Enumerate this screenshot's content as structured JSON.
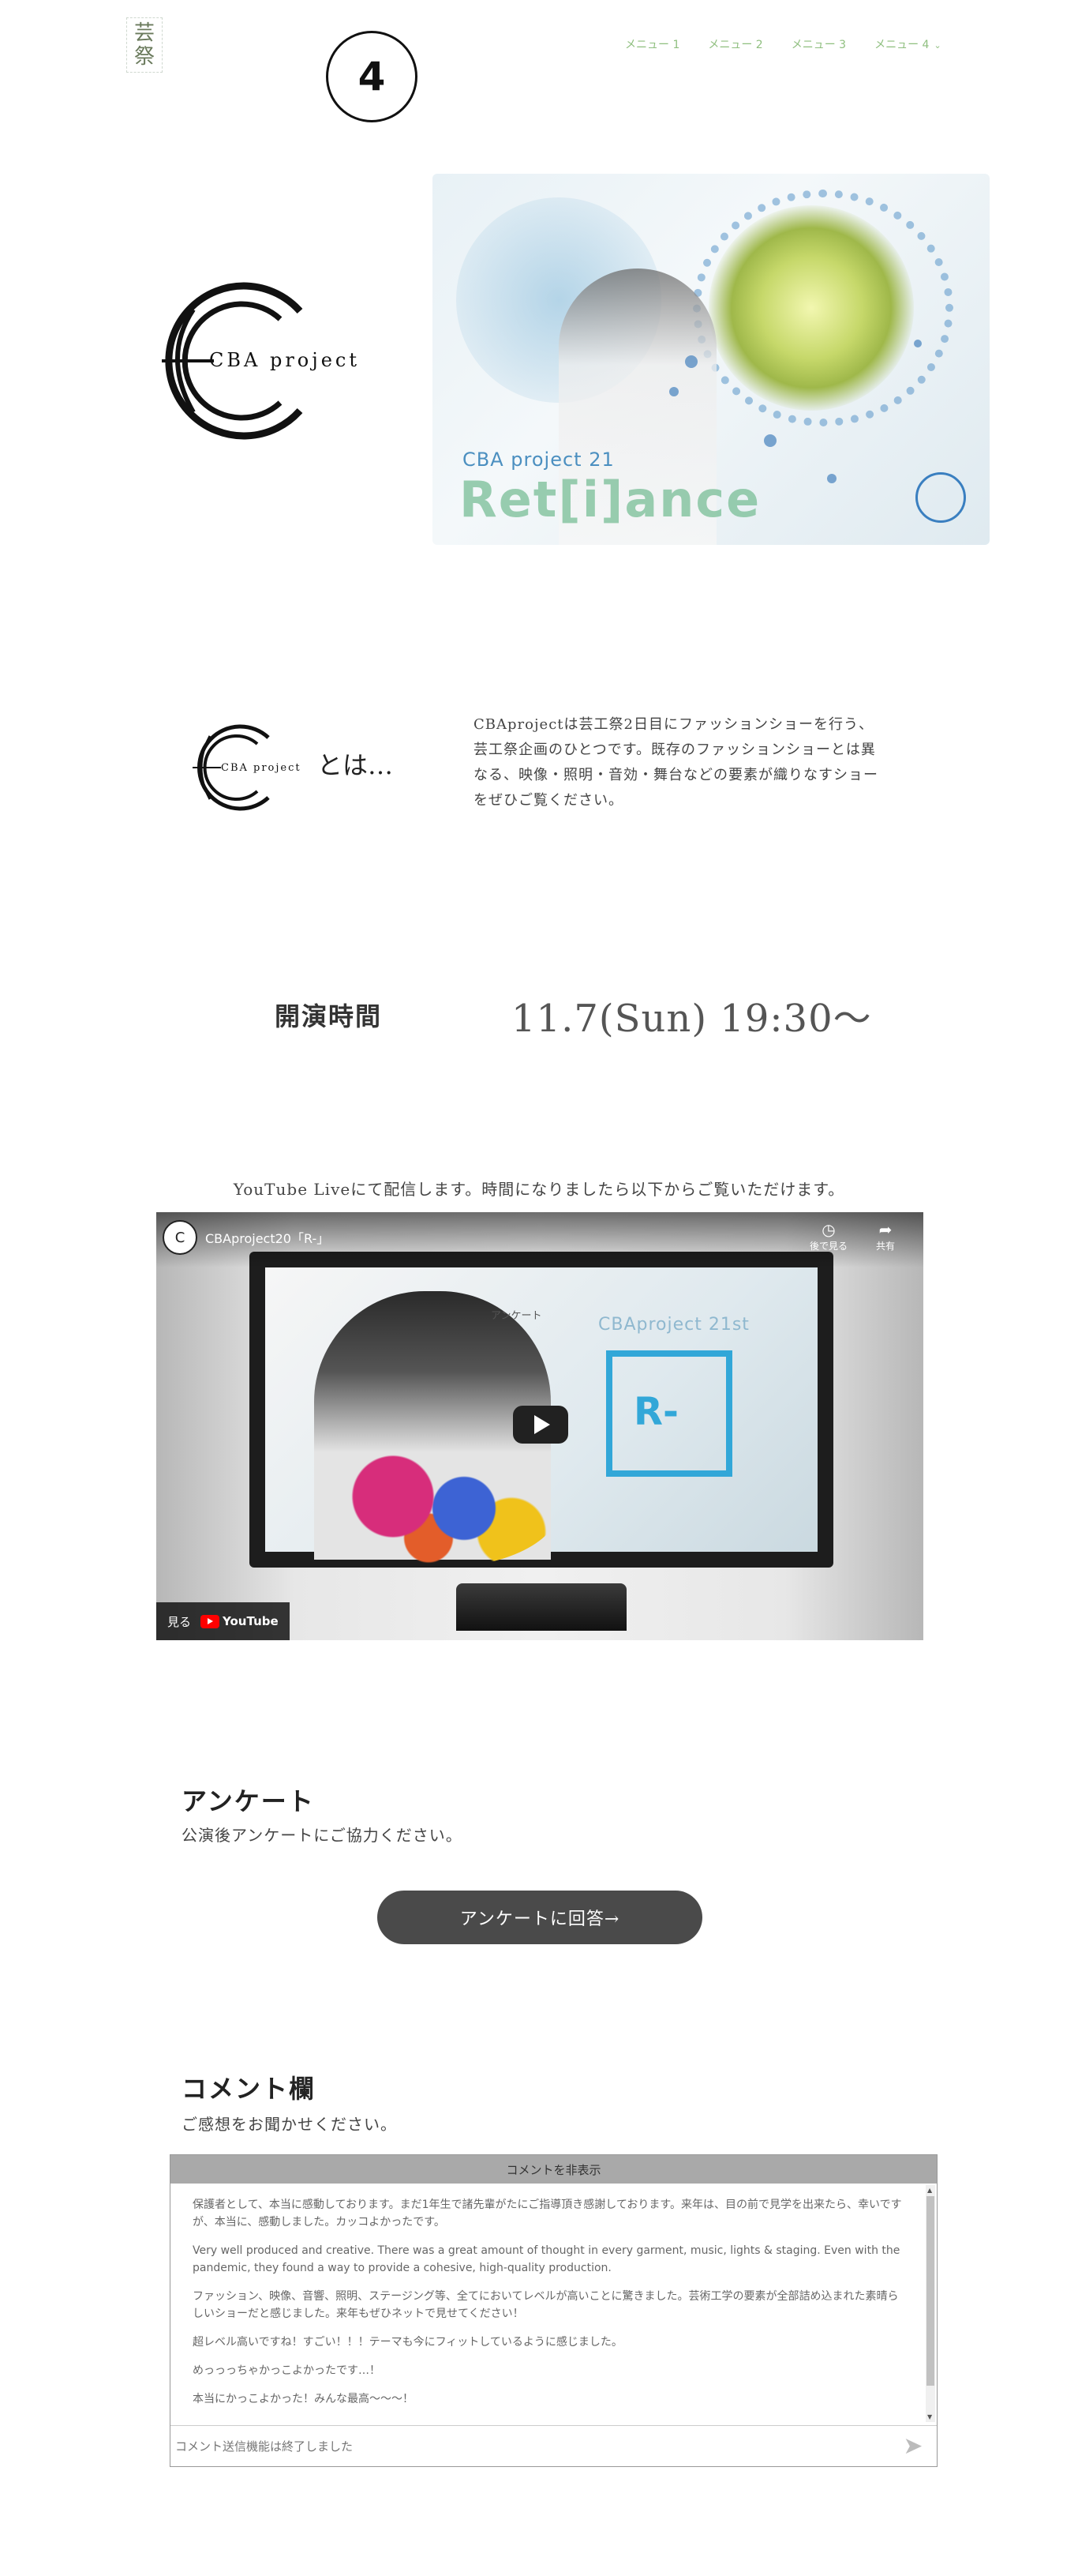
{
  "header": {
    "logo_chars": [
      "芸",
      "祭"
    ],
    "badge_number": "4",
    "nav": [
      {
        "label": "メニュー 1"
      },
      {
        "label": "メニュー 2"
      },
      {
        "label": "メニュー 3"
      },
      {
        "label": "メニュー 4"
      }
    ],
    "accent_color": "#8fbf7f"
  },
  "hero": {
    "logo_text": "CBA project",
    "image_small_title": "CBA project 21",
    "image_big_title": "Ret[i]ance"
  },
  "about": {
    "logo_text": "CBA project",
    "suffix": "とは…",
    "description": "CBAprojectは芸工祭2日目にファッションショーを行う、芸工祭企画のひとつです。既存のファッションショーとは異なる、映像・照明・音効・舞台などの要素が織りなすショーをぜひご覧ください。"
  },
  "showtime": {
    "label": "開演時間",
    "value": "11.7(Sun) 19:30〜"
  },
  "live": {
    "note": "YouTube Liveにて配信します。時間になりましたら以下からご覧いただけます。",
    "video": {
      "title": "CBAproject20「R-」",
      "watch_later": "後で見る",
      "share": "共有",
      "watch_on": "見る",
      "youtube": "YouTube",
      "overlay_small": "アンケート",
      "overlay_brand": "CBAproject 21st",
      "overlay_r": "R-"
    }
  },
  "survey": {
    "title": "アンケート",
    "subtitle": "公演後アンケートにご協力ください。",
    "button": "アンケートに回答→"
  },
  "comments": {
    "title": "コメント欄",
    "subtitle": "ご感想をお聞かせください。",
    "hide_label": "コメントを非表示",
    "items": [
      "保護者として、本当に感動しております。まだ1年生で諸先輩がたにご指導頂き感謝しております。来年は、目の前で見学を出来たら、幸いですが、本当に、感動しました。カッコよかったです。",
      "Very well produced and creative. There was a great amount of thought in every garment, music, lights & staging. Even with the pandemic, they found a way to provide a cohesive, high-quality production.",
      "ファッション、映像、音響、照明、ステージング等、全てにおいてレベルが高いことに驚きました。芸術工学の要素が全部詰め込まれた素晴らしいショーだと感じました。来年もぜひネットで見せてください！",
      "超レベル高いですね！すごい！！！テーマも今にフィットしているように感じました。",
      "めっっっちゃかっこよかったです…！",
      "本当にかっこよかった！みんな最高〜〜〜！"
    ],
    "input_placeholder": "コメント送信機能は終了しました"
  }
}
